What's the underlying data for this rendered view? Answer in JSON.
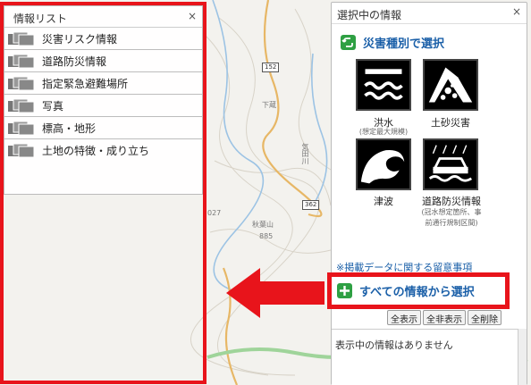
{
  "map": {
    "place_labels": [
      "秋葉山",
      "885",
      "下蔵",
      "気田川",
      "027"
    ],
    "route_numbers": [
      "152",
      "362"
    ]
  },
  "list_panel": {
    "title": "情報リスト",
    "close": "×",
    "items": [
      {
        "label": "災害リスク情報"
      },
      {
        "label": "道路防災情報"
      },
      {
        "label": "指定緊急避難場所"
      },
      {
        "label": "写真"
      },
      {
        "label": "標高・地形"
      },
      {
        "label": "土地の特徴・成り立ち"
      }
    ]
  },
  "selection_panel": {
    "title": "選択中の情報",
    "close": "×",
    "hazard_section_label": "災害種別で選択",
    "hazards": [
      {
        "label": "洪水",
        "note": "(想定最大規模)",
        "icon": "flood-icon"
      },
      {
        "label": "土砂災害",
        "note": "",
        "icon": "landslide-icon"
      },
      {
        "label": "津波",
        "note": "",
        "icon": "tsunami-icon"
      },
      {
        "label": "道路防災情報",
        "note": "(冠水想定箇所、事前通行規制区間)",
        "icon": "road-disaster-icon"
      }
    ],
    "notice_link": "※掲載データに関する留意事項",
    "all_info_label": "すべての情報から選択",
    "buttons": {
      "show_all": "全表示",
      "hide_all": "全非表示",
      "delete_all": "全削除"
    },
    "empty_message": "表示中の情報はありません"
  },
  "colors": {
    "highlight_red": "#e8141b",
    "link_blue": "#1a5fa8",
    "icon_green": "#2ea043"
  }
}
